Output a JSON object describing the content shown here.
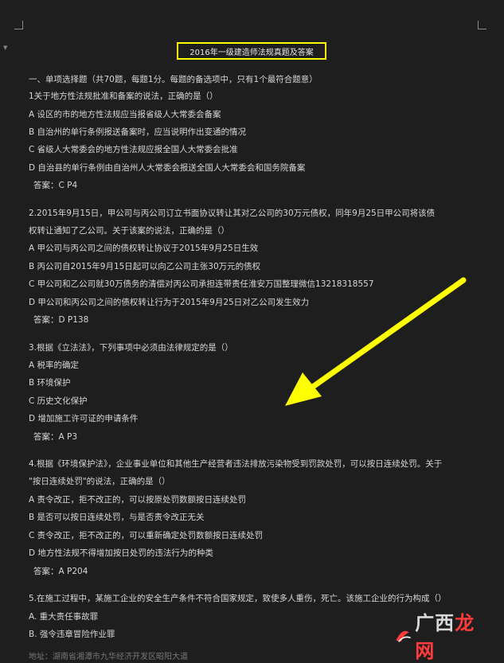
{
  "doc": {
    "title": "2016年一级建造师法规真题及答案",
    "section_heading": "一、单项选择题（共70题，每题1分。每题的备选项中，只有1个最符合题意）",
    "questions": [
      {
        "stem": [
          "1关于地方性法规批准和备案的说法，正确的是（）"
        ],
        "options": [
          "A 设区的市的地方性法规应当报省级人大常委会备案",
          "B 自治州的单行条例报送备案时，应当说明作出变通的情况",
          "C 省级人大常委会的地方性法规应报全国人大常委会批准",
          "D 自治县的单行条例由自治州人大常委会报送全国人大常委会和国务院备案"
        ],
        "answer": "答案：C P4"
      },
      {
        "stem": [
          "2.2015年9月15日，甲公司与丙公司订立书面协议转让其对乙公司的30万元债权，同年9月25日甲公司将该债",
          "权转让通知了乙公司。关于该案的说法，正确的是（）"
        ],
        "options": [
          "A 甲公司与丙公司之间的债权转让协议于2015年9月25日生效",
          "B 丙公司自2015年9月15日起可以向乙公司主张30万元的债权",
          "C 甲公司和乙公司就30万债务的清偿对丙公司承担连带责任淮安万国整理微信13218318557",
          "D 甲公司和丙公司之间的债权转让行为于2015年9月25日对乙公司发生效力"
        ],
        "answer": "答案：D P138"
      },
      {
        "stem": [
          "3.根据《立法法》，下列事项中必须由法律规定的是（）"
        ],
        "options": [
          "A 税率的确定",
          "B 环境保护",
          "C 历史文化保护",
          "D 增加施工许可证的申请条件"
        ],
        "answer": "答案：A P3"
      },
      {
        "stem": [
          "4.根据《环境保护法》，企业事业单位和其他生产经营者违法排放污染物受到罚款处罚，可以按日连续处罚。关于",
          "\"按日连续处罚\"的说法，正确的是（）"
        ],
        "options": [
          "A 责令改正，拒不改正的，可以按原处罚数额按日连续处罚",
          "B 是否可以按日连续处罚，与是否责令改正无关",
          "C 责令改正，拒不改正的，可以重新确定处罚数额按日连续处罚",
          "D 地方性法规不得增加按日处罚的违法行为的种类"
        ],
        "answer": "答案：A P204"
      },
      {
        "stem": [
          "5.在施工过程中，某施工企业的安全生产条件不符合国家规定，致使多人重伤，死亡。该施工企业的行为构成（）"
        ],
        "options": [
          "A. 重大责任事故罪",
          "B. 强令违章冒险作业罪"
        ],
        "answer": ""
      }
    ],
    "cut_line": "地址：湖南省湘潭市九华经济开发区昭阳大道"
  },
  "watermark": {
    "left": "广西",
    "right": "龙网"
  },
  "colors": {
    "background": "#1e1e1e",
    "text": "#d6d6d6",
    "highlight": "#ffff00",
    "watermark_red": "#ff3b3b"
  }
}
